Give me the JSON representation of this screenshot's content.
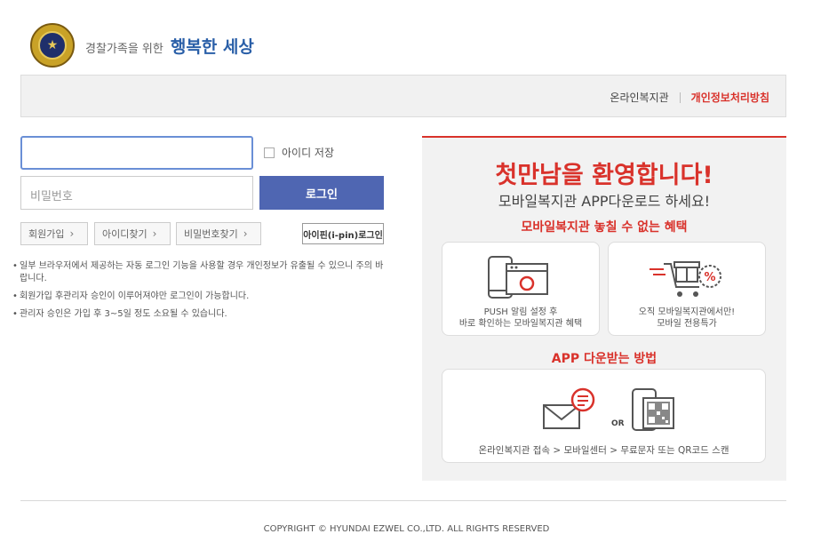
{
  "header": {
    "slogan_small": "경찰가족을 위한",
    "slogan_big": "행복한 세상",
    "links": [
      "온라인복지관",
      "개인정보처리방침"
    ]
  },
  "login": {
    "id_placeholder": "",
    "save_id_label": "아이디 저장",
    "password_placeholder": "비밀번호",
    "login_button": "로그인",
    "signup_button": "회원가입",
    "find_id_button": "아이디찾기",
    "find_pw_button": "비밀번호찾기",
    "ipin_button": "아이핀(i-pin)로그인",
    "notes": [
      "일부 브라우저에서 제공하는 자동 로그인 기능을 사용할 경우 개인정보가 유출될 수 있으니 주의 바랍니다.",
      "회원가입 후관리자 승인이 이루어져야만 로그인이 가능합니다.",
      "관리자 승인은 가입 후 3~5일 정도 소요될 수 있습니다."
    ]
  },
  "promo": {
    "headline": "첫만남을 환영합니다!",
    "subheadline": "모바일복지관 APP다운로드 하세요!",
    "benefits_title": "모바일복지관 놓칠 수 없는 혜택",
    "benefit1": [
      "PUSH 알림 설정 후",
      "바로 확인하는 모바일복지관 혜택"
    ],
    "benefit2": [
      "오직 모바일복지관에서만!",
      "모바일 전용특가"
    ],
    "download_title": "APP 다운받는 방법",
    "or_label": "OR",
    "download_steps": "온라인복지관 접속 > 모바일센터 > 무료문자 또는 QR코드 스캔"
  },
  "footer": {
    "copyright": "COPYRIGHT © HYUNDAI EZWEL CO.,LTD. ALL RIGHTS RESERVED"
  },
  "colors": {
    "accent_red": "#d9322b",
    "login_blue": "#4f66b2",
    "slogan_blue": "#2a5fa8"
  },
  "icons": [
    "police-emblem",
    "phone-browser-bell-icon",
    "gift-cart-discount-icon",
    "mail-message-icon",
    "phone-qr-icon"
  ]
}
